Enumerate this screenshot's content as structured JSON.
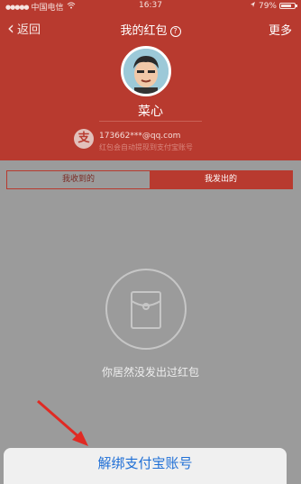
{
  "status_bar": {
    "carrier": "中国电信",
    "time": "16:37",
    "battery_percent": "79%",
    "battery_level": 0.79
  },
  "nav": {
    "back_label": "返回",
    "title": "我的红包",
    "help_label": "?",
    "more_label": "更多"
  },
  "profile": {
    "name": "菜心",
    "alipay_icon_label": "支",
    "email": "173662***@qq.com",
    "hint": "红包会自动提现到支付宝账号"
  },
  "tabs": [
    {
      "label": "我收到的",
      "selected": false
    },
    {
      "label": "我发出的",
      "selected": true
    }
  ],
  "empty_state": {
    "message": "你居然没发出过红包"
  },
  "action_sheet": {
    "unbind_label": "解绑支付宝账号"
  },
  "colors": {
    "brand_red": "#b83a2f",
    "link_blue": "#1f6fd6",
    "overlay_gray": "#9b9b9b"
  }
}
